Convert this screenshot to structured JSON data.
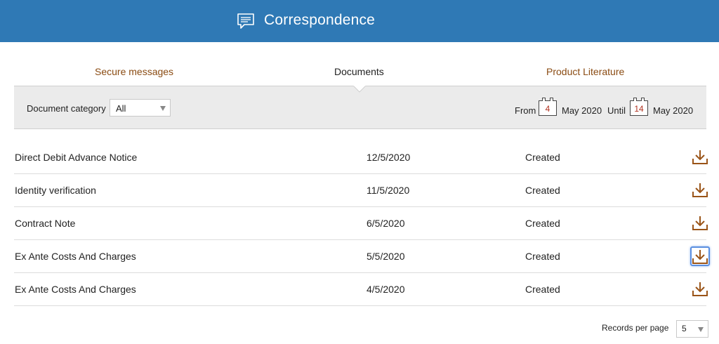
{
  "header": {
    "title": "Correspondence",
    "icon": "message-icon",
    "color": "#2f79b5"
  },
  "tabs": [
    {
      "label": "Secure messages",
      "active": false
    },
    {
      "label": "Documents",
      "active": true
    },
    {
      "label": "Product Literature",
      "active": false
    }
  ],
  "filters": {
    "category_label": "Document category",
    "category_value": "All",
    "from_label": "From",
    "from_day": "4",
    "from_month_year": "May 2020",
    "until_label": "Until",
    "until_day": "14",
    "until_month_year": "May 2020"
  },
  "documents": [
    {
      "name": "Direct Debit Advance Notice",
      "date": "12/5/2020",
      "status": "Created",
      "icon": "download-icon"
    },
    {
      "name": "Identity verification",
      "date": "11/5/2020",
      "status": "Created",
      "icon": "download-icon"
    },
    {
      "name": "Contract Note",
      "date": "6/5/2020",
      "status": "Created",
      "icon": "download-icon"
    },
    {
      "name": "Ex Ante Costs And Charges",
      "date": "5/5/2020",
      "status": "Created",
      "icon": "download-icon",
      "focused": true
    },
    {
      "name": "Ex Ante Costs And Charges",
      "date": "4/5/2020",
      "status": "Created",
      "icon": "download-icon"
    }
  ],
  "pagination": {
    "records_label": "Records per page",
    "records_value": "5"
  },
  "colors": {
    "accent_link": "#8a4b12",
    "download_icon": "#9a5418"
  }
}
